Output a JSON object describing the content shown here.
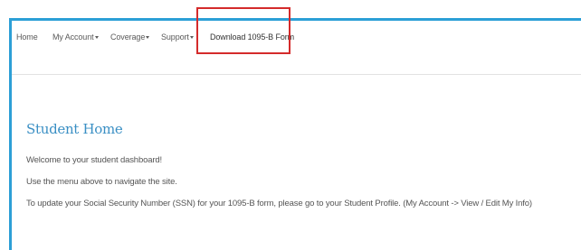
{
  "nav": {
    "home": "Home",
    "my_account": "My Account",
    "coverage": "Coverage",
    "support": "Support",
    "download": "Download 1095-B Form"
  },
  "content": {
    "title": "Student Home",
    "line1": "Welcome to your student dashboard!",
    "line2": "Use the menu above to navigate the site.",
    "line3": "To update your Social Security Number (SSN) for your 1095-B form, please go to your Student Profile. (My Account -> View / Edit My Info)"
  },
  "colors": {
    "frame_accent": "#2c9fd6",
    "highlight_box": "#d42b2b",
    "title": "#3a8fc4"
  }
}
